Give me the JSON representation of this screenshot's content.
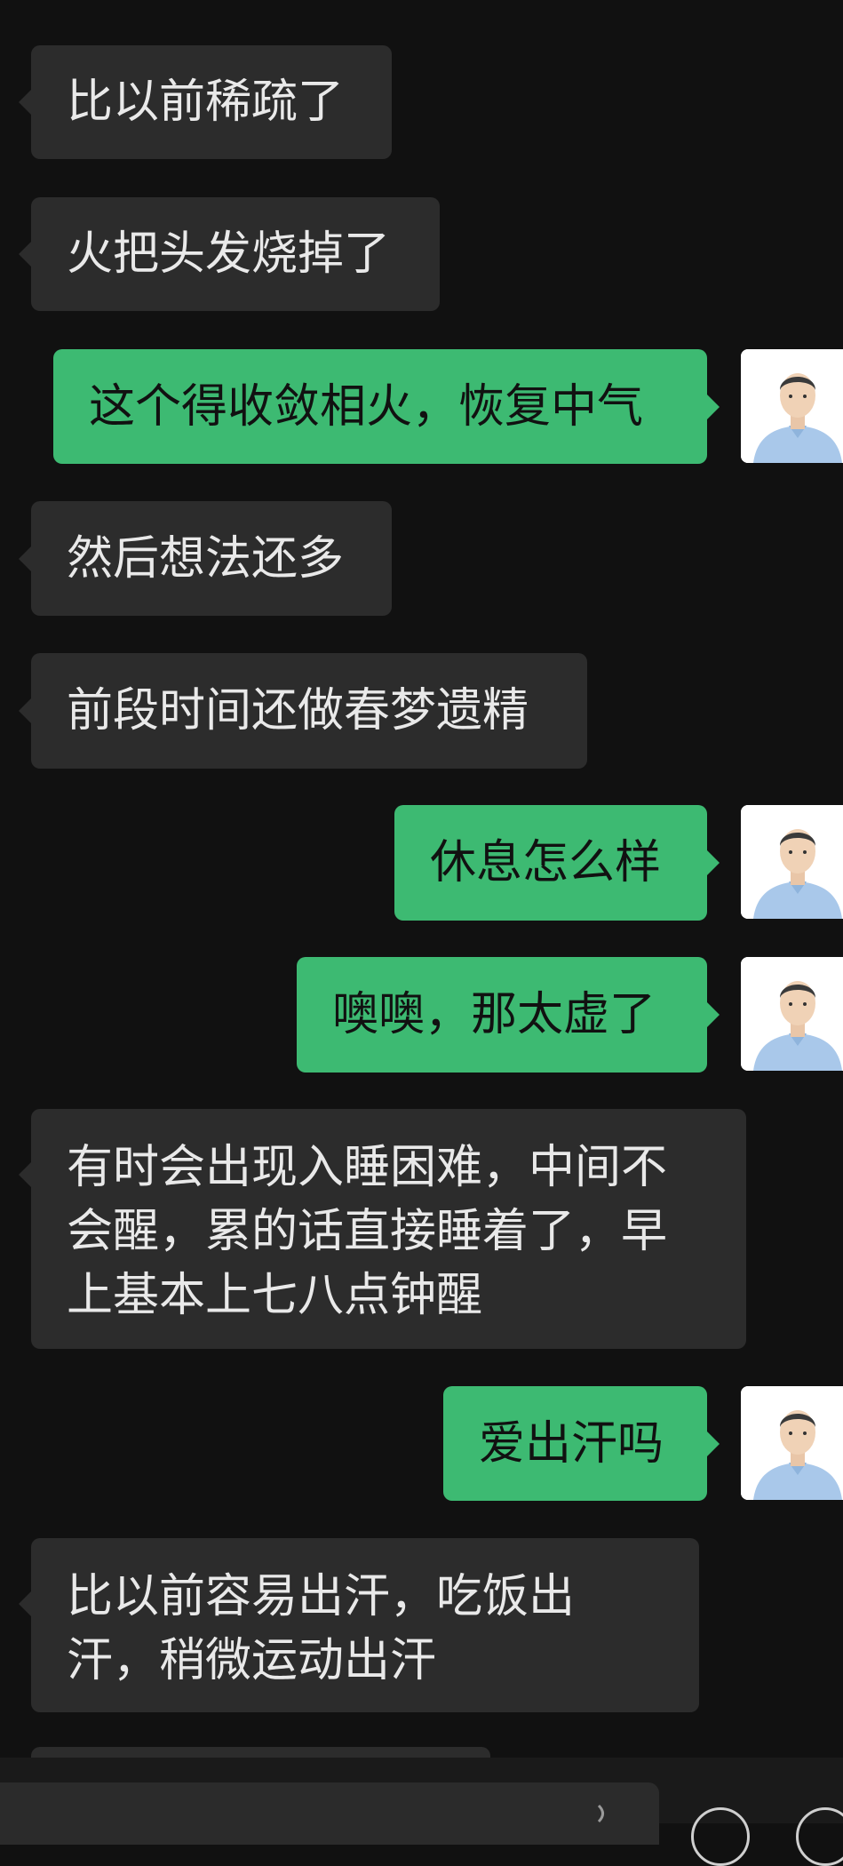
{
  "messages": [
    {
      "side": "incoming",
      "text": "比以前稀疏了"
    },
    {
      "side": "incoming",
      "text": "火把头发烧掉了"
    },
    {
      "side": "outgoing",
      "text": "这个得收敛相火，恢复中气"
    },
    {
      "side": "incoming",
      "text": "然后想法还多"
    },
    {
      "side": "incoming",
      "text": "前段时间还做春梦遗精"
    },
    {
      "side": "outgoing",
      "text": "休息怎么样"
    },
    {
      "side": "outgoing",
      "text": "噢噢，那太虚了"
    },
    {
      "side": "incoming",
      "text": "有时会出现入睡困难，中间不会醒，累的话直接睡着了，早上基本上七八点钟醒"
    },
    {
      "side": "outgoing",
      "text": "爱出汗吗"
    },
    {
      "side": "incoming",
      "text": "比以前容易出汗，吃饭出汗，稍微运动出汗"
    }
  ],
  "colors": {
    "background": "#111111",
    "incoming_bubble": "#2c2c2c",
    "outgoing_bubble": "#3dba72"
  },
  "icons": {
    "avatar": "doctor-avatar-icon",
    "input_voice": "voice-icon",
    "emoji": "emoji-icon",
    "more": "plus-icon"
  }
}
